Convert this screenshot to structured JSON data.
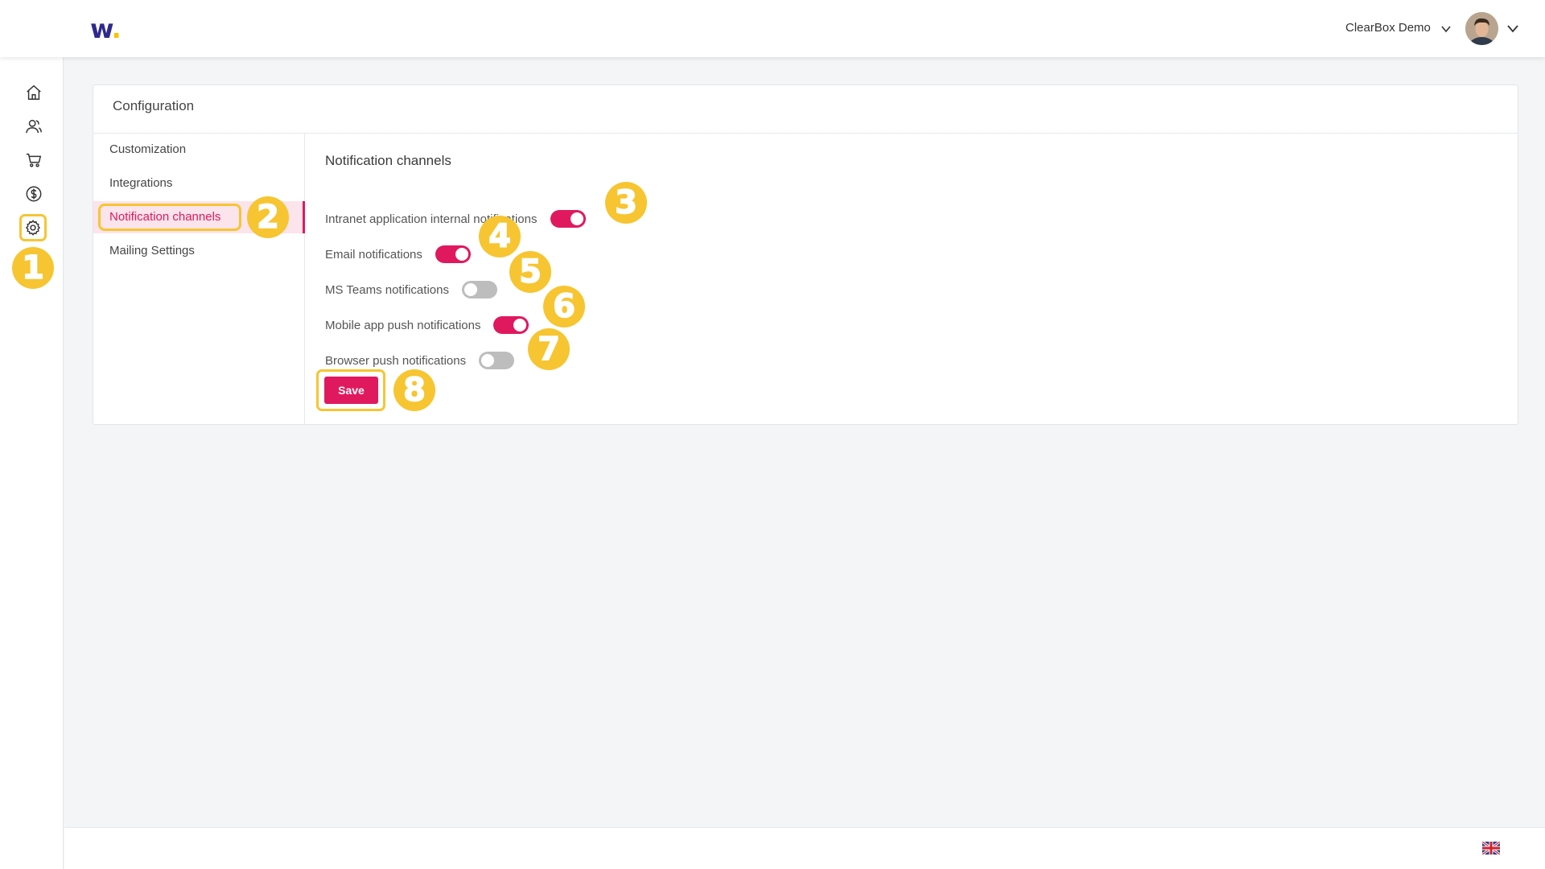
{
  "brand": {
    "logo_letter": "w",
    "logo_dot": "."
  },
  "header": {
    "account_name": "ClearBox Demo"
  },
  "sidebar": {
    "items": [
      {
        "icon": "home-icon"
      },
      {
        "icon": "users-icon"
      },
      {
        "icon": "cart-icon"
      },
      {
        "icon": "dollar-icon"
      },
      {
        "icon": "gear-icon",
        "active": true
      }
    ]
  },
  "page": {
    "title": "Configuration"
  },
  "subnav": {
    "items": [
      {
        "label": "Customization"
      },
      {
        "label": "Integrations"
      },
      {
        "label": "Notification channels",
        "active": true
      },
      {
        "label": "Mailing Settings"
      }
    ]
  },
  "settings": {
    "section_title": "Notification channels",
    "channels": [
      {
        "label": "Intranet application internal notifications",
        "enabled": true
      },
      {
        "label": "Email notifications",
        "enabled": true
      },
      {
        "label": "MS Teams notifications",
        "enabled": false
      },
      {
        "label": "Mobile app push notifications",
        "enabled": true
      },
      {
        "label": "Browser push notifications",
        "enabled": false
      }
    ],
    "save_label": "Save"
  },
  "callouts": [
    "1",
    "2",
    "3",
    "4",
    "5",
    "6",
    "7",
    "8"
  ],
  "colors": {
    "accent": "#e0195e",
    "highlight": "#f7c531",
    "brand": "#2e2a8c"
  }
}
